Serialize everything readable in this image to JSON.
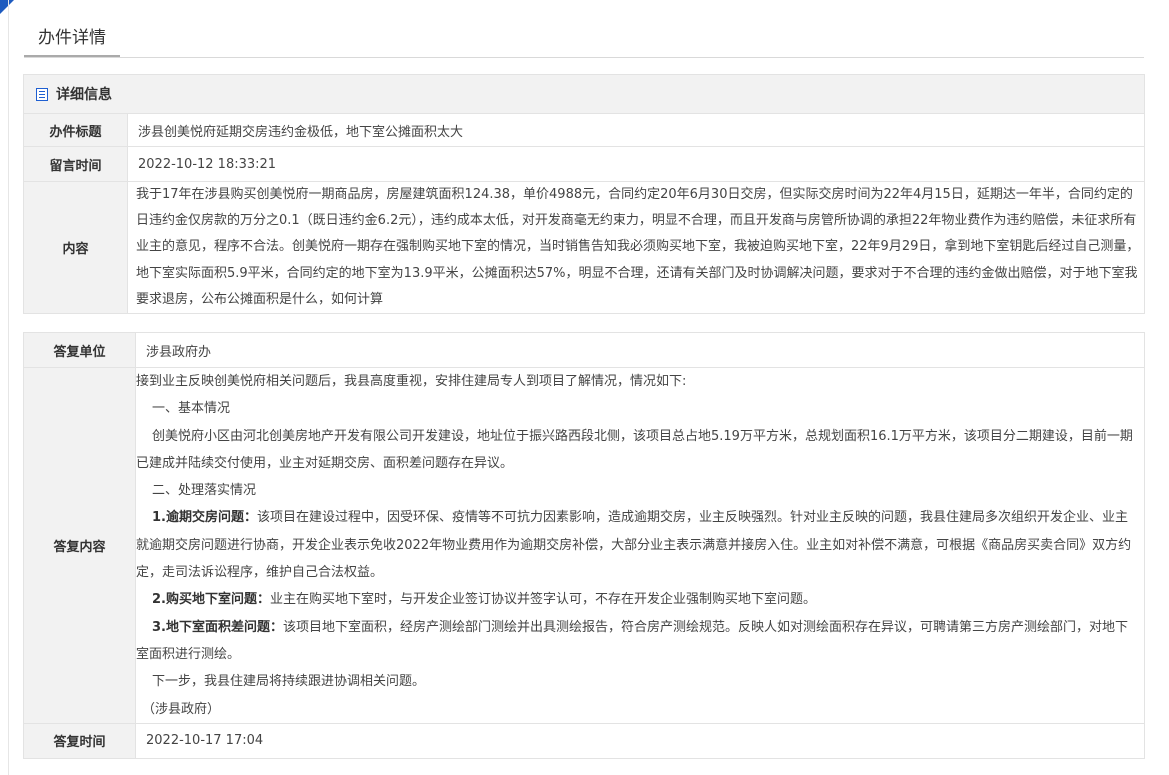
{
  "page_title": "办件详情",
  "detail_section": {
    "title": "详细信息",
    "icon": "list-icon",
    "rows": {
      "subject": {
        "label": "办件标题",
        "value": "涉县创美悦府延期交房违约金极低，地下室公摊面积太大"
      },
      "message_time": {
        "label": "留言时间",
        "value": "2022-10-12 18:33:21"
      },
      "content": {
        "label": "内容",
        "value": " 我于17年在涉县购买创美悦府一期商品房，房屋建筑面积124.38，单价4988元，合同约定20年6月30日交房，但实际交房时间为22年4月15日，延期达一年半，合同约定的日违约金仅房款的万分之0.1（既日违约金6.2元），违约成本太低，对开发商毫无约束力，明显不合理，而且开发商与房管所协调的承担22年物业费作为违约赔偿，未征求所有业主的意见，程序不合法。创美悦府一期存在强制购买地下室的情况，当时销售告知我必须购买地下室，我被迫购买地下室，22年9月29日，拿到地下室钥匙后经过自己测量，地下室实际面积5.9平米，合同约定的地下室为13.9平米，公摊面积达57%，明显不合理，还请有关部门及时协调解决问题，要求对于不合理的违约金做出赔偿，对于地下室我要求退房，公布公摊面积是什么，如何计算"
      }
    }
  },
  "reply_section": {
    "unit": {
      "label": "答复单位",
      "value": "涉县政府办"
    },
    "content_label": "答复内容",
    "content": {
      "intro": "接到业主反映创美悦府相关问题后，我县高度重视，安排住建局专人到项目了解情况，情况如下:",
      "h1": "一、基本情况",
      "basic": "创美悦府小区由河北创美房地产开发有限公司开发建设，地址位于振兴路西段北侧，该项目总占地5.19万平方米，总规划面积16.1万平方米，该项目分二期建设，目前一期已建成并陆续交付使用，业主对延期交房、面积差问题存在异议。",
      "h2": "二、处理落实情况",
      "item1_title": "1.逾期交房问题：",
      "item1_text": "该项目在建设过程中，因受环保、疫情等不可抗力因素影响，造成逾期交房，业主反映强烈。针对业主反映的问题，我县住建局多次组织开发企业、业主就逾期交房问题进行协商，开发企业表示免收2022年物业费用作为逾期交房补偿，大部分业主表示满意并接房入住。业主如对补偿不满意，可根据《商品房买卖合同》双方约定，走司法诉讼程序，维护自己合法权益。",
      "item2_title": "2.购买地下室问题：",
      "item2_text": "业主在购买地下室时，与开发企业签订协议并签字认可，不存在开发企业强制购买地下室问题。",
      "item3_title": "3.地下室面积差问题：",
      "item3_text": "该项目地下室面积，经房产测绘部门测绘并出具测绘报告，符合房产测绘规范。反映人如对测绘面积存在异议，可聘请第三方房产测绘部门，对地下室面积进行测绘。",
      "next": "下一步，我县住建局将持续跟进协调相关问题。",
      "sign": "（涉县政府）"
    },
    "time": {
      "label": "答复时间",
      "value": "2022-10-17 17:04"
    }
  },
  "colors": {
    "accent": "#1e5bbf",
    "label_bg": "#f2f2f2",
    "border": "#e3e3e3"
  }
}
